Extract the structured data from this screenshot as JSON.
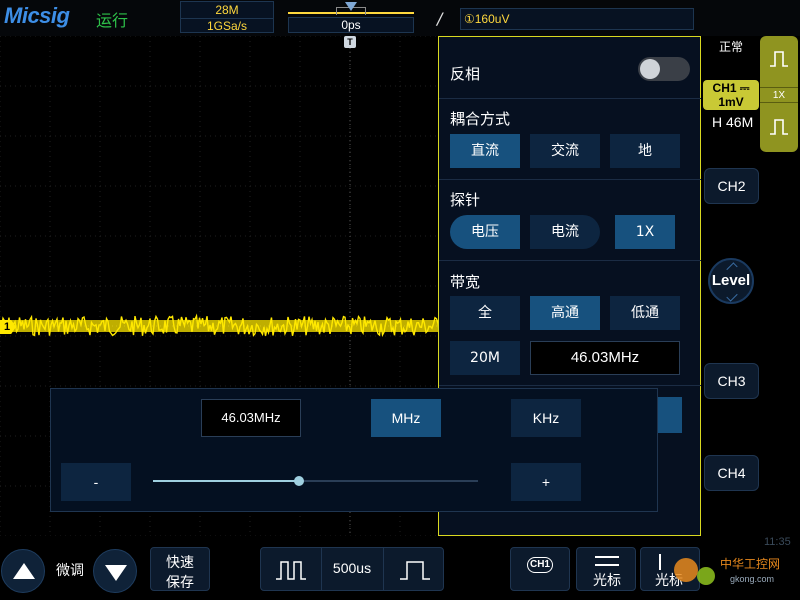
{
  "topbar": {
    "brand": "Micsig",
    "run_status": "运行",
    "memory_depth": "28M",
    "sample_rate": "1GSa/s",
    "trigger_position": "0ps",
    "trigger_slope_icon": "/",
    "trigger_level": "①160uV"
  },
  "scope": {
    "trigger_marker": "T",
    "channel_marker": "1",
    "trace_color": "#ffe800"
  },
  "sidebar": {
    "run_mode": "正常",
    "ch1_badge": {
      "line1": "CH1 ⎓",
      "line2": "1mV"
    },
    "ch1_offset": "H 46M",
    "ch1_probe": "1X",
    "ch2": "CH2",
    "level": "Level",
    "ch3": "CH3",
    "ch4": "CH4"
  },
  "panel": {
    "invert_label": "反相",
    "invert_on": false,
    "coupling_label": "耦合方式",
    "coupling_options": [
      "直流",
      "交流",
      "地"
    ],
    "coupling_selected": 0,
    "probe_label": "探针",
    "probe_options": [
      "电压",
      "电流"
    ],
    "probe_selected": 0,
    "probe_ratio": "1X",
    "bandwidth_label": "带宽",
    "bandwidth_options": [
      "全",
      "高通",
      "低通"
    ],
    "bandwidth_selected": 1,
    "bw_20m": "20M",
    "bw_value": "46.03MHz"
  },
  "finetune": {
    "value": "46.03MHz",
    "unit_mhz": "MHz",
    "unit_khz": "KHz",
    "minus": "-",
    "plus": "+",
    "slider_fraction": 0.45
  },
  "bottombar": {
    "fine_label": "微调",
    "quick_save_line1": "快速",
    "quick_save_line2": "保存",
    "timebase": "500us",
    "ch1_chip": "CH1",
    "cursor1": "光标",
    "cursor2": "光标",
    "clock": "11:35",
    "watermark_text": "中华工控网",
    "watermark_url": "gkong.com"
  }
}
